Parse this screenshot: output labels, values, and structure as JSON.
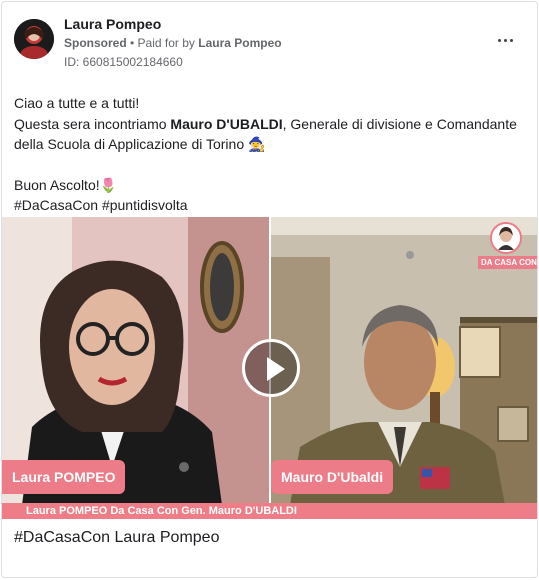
{
  "post": {
    "author": "Laura Pompeo",
    "sponsored_label": "Sponsored",
    "paid_for_prefix": " • Paid for by ",
    "paid_for_name": "Laura Pompeo",
    "ad_id": "ID: 660815002184660",
    "more_icon": "more-dots-icon"
  },
  "body": {
    "line1": "Ciao a tutte e a tutti!",
    "line2_pre": "Questa sera incontriamo ",
    "line2_bold": "Mauro D'UBALDI",
    "line2_post": ", Generale di divisione e Comandante della Scuola di Applicazione di Torino",
    "line2_emoji": "🧙‍♀️",
    "line3": "Buon Ascolto!",
    "line3_emoji": "🌷",
    "hashtags": "#DaCasaCon #puntidisvolta"
  },
  "media": {
    "left_name": "Laura POMPEO",
    "right_name": "Mauro D'Ubaldi",
    "caption": "Laura POMPEO Da Casa Con Gen. Mauro D'UBALDI",
    "badge_label": "DA CASA CON",
    "play_icon": "play-icon"
  },
  "footer": {
    "title": "#DaCasaCon Laura Pompeo"
  },
  "colors": {
    "accent_pink": "#ec7c87",
    "text_secondary": "#65676b"
  }
}
